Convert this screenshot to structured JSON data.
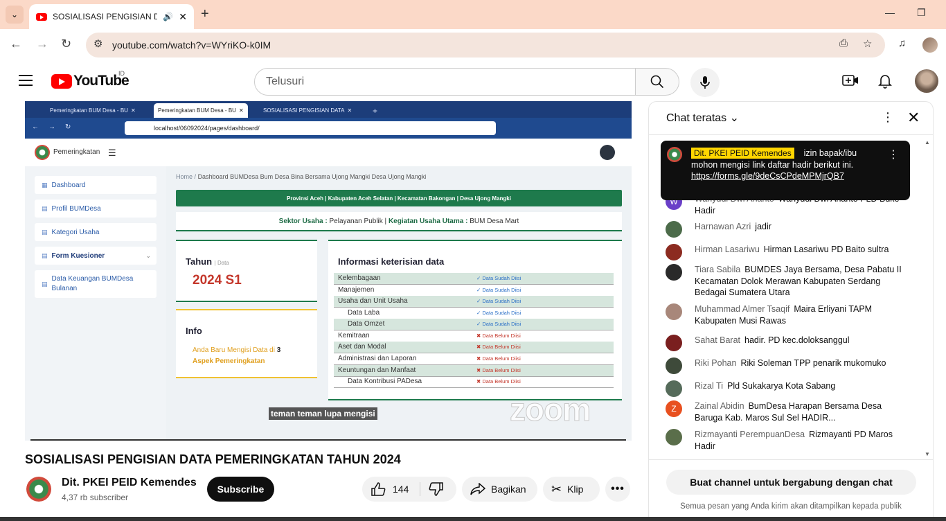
{
  "browser": {
    "tab_title": "SOSIALISASI PENGISIAN DA",
    "url": "youtube.com/watch?v=WYriKO-k0IM"
  },
  "youtube": {
    "logo_text": "YouTube",
    "country_code": "ID",
    "search_placeholder": "Telusuri"
  },
  "video": {
    "inner_browser": {
      "tabs": [
        "Pemeringkatan BUM Desa - BU",
        "Pemeringkatan BUM Desa - BU",
        "SOSIALISASI PENGISIAN DATA"
      ],
      "url": "localhost/06092024/pages/dashboard/"
    },
    "app": {
      "name": "Pemeringkatan",
      "sidebar": [
        "Dashboard",
        "Profil BUMDesa",
        "Kategori Usaha",
        "Form Kuesioner",
        "Data Keuangan BUMDesa Bulanan"
      ],
      "breadcrumb_home": "Home",
      "breadcrumb_sep": "/",
      "breadcrumb_page": "Dashboard BUMDesa Bum Desa Bina Bersama Ujong Mangki Desa Ujong Mangki",
      "location_bar": "Provinsi Aceh | Kabupaten Aceh Selatan | Kecamatan Bakongan | Desa Ujong Mangki",
      "sektor_label": "Sektor Usaha :",
      "sektor_value": "Pelayanan Publik",
      "sep": "|",
      "kegiatan_label": "Kegiatan Usaha Utama :",
      "kegiatan_value": "BUM Desa Mart",
      "tahun_label": "Tahun",
      "tahun_sub": "| Data",
      "tahun_value": "2024 S1",
      "info_title": "Info",
      "info_text": "Anda Baru Mengisi Data di",
      "info_count": "3",
      "info_text2": "Aspek Pemeringkatan",
      "table_title": "Informasi keterisian data",
      "rows": [
        {
          "label": "Kelembagaan",
          "status": "✓ Data Sudah Diisi"
        },
        {
          "label": "Manajemen",
          "status": "✓ Data Sudah Diisi"
        },
        {
          "label": "Usaha dan Unit Usaha",
          "status": "✓ Data Sudah Diisi"
        },
        {
          "label": "Data Laba",
          "status": "✓ Data Sudah Diisi"
        },
        {
          "label": "Data Omzet",
          "status": "✓ Data Sudah Diisi"
        },
        {
          "label": "Kemitraan",
          "status": "✖ Data Belum Diisi"
        },
        {
          "label": "Aset dan Modal",
          "status": "✖ Data Belum Diisi"
        },
        {
          "label": "Administrasi dan Laporan",
          "status": "✖ Data Belum Diisi"
        },
        {
          "label": "Keuntungan dan Manfaat",
          "status": "✖ Data Belum Diisi"
        },
        {
          "label": "Data Kontribusi PADesa",
          "status": "✖ Data Belum Diisi"
        }
      ]
    },
    "caption": "teman teman lupa mengisi",
    "watermark": "zoom",
    "title": "SOSIALISASI PENGISIAN DATA PEMERINGKATAN TAHUN 2024"
  },
  "channel": {
    "name": "Dit. PKEI PEID Kemendes",
    "subscribers": "4,37 rb subscriber",
    "subscribe_label": "Subscribe"
  },
  "actions": {
    "likes": "144",
    "share": "Bagikan",
    "clip": "Klip"
  },
  "chat": {
    "header": "Chat teratas",
    "pinned": {
      "author": "Dit. PKEI PEID Kemendes",
      "text1": "izin",
      "text2": "bapak/ibu mohon mengisi link daftar hadir berikut ini.",
      "link": "https://forms.gle/9deCsCPdeMPMjrQB7"
    },
    "messages": [
      {
        "author": "Wahyudi Dwi Ananto",
        "text": "Wahyudi Dwi Ananto PLD Buke Hadir",
        "color": "#6a3fc8",
        "letter": "W"
      },
      {
        "author": "Harnawan Azri",
        "text": "jadir",
        "color": "#4c6b4a",
        "letter": ""
      },
      {
        "author": "Hirman Lasariwu",
        "text": "Hirman Lasariwu PD Baito sultra",
        "color": "#8c2b20",
        "letter": ""
      },
      {
        "author": "Tiara Sabila",
        "text": "BUMDES Jaya Bersama, Desa Pabatu II Kecamatan Dolok Merawan Kabupaten Serdang Bedagai Sumatera Utara",
        "color": "#2a2a2a",
        "letter": ""
      },
      {
        "author": "Muhammad Almer Tsaqif",
        "text": "Maira Erliyani TAPM Kabupaten Musi Rawas",
        "color": "#a8877a",
        "letter": ""
      },
      {
        "author": "Sahat Barat",
        "text": "hadir. PD kec.doloksanggul",
        "color": "#7a1f1f",
        "letter": ""
      },
      {
        "author": "Riki Pohan",
        "text": "Riki Soleman TPP penarik mukomuko",
        "color": "#3e4a3a",
        "letter": ""
      },
      {
        "author": "Rizal Ti",
        "text": "Pld Sukakarya Kota Sabang",
        "color": "#556b5a",
        "letter": ""
      },
      {
        "author": "Zainal Abidin",
        "text": "BumDesa Harapan Bersama Desa Baruga Kab. Maros Sul Sel HADIR...",
        "color": "#e8501f",
        "letter": "Z"
      },
      {
        "author": "Rizmayanti PerempuanDesa",
        "text": "Rizmayanti PD Maros Hadir",
        "color": "#5a6e4a",
        "letter": ""
      }
    ],
    "join_button": "Buat channel untuk bergabung dengan chat",
    "footer": "Semua pesan yang Anda kirim akan ditampilkan kepada publik"
  }
}
